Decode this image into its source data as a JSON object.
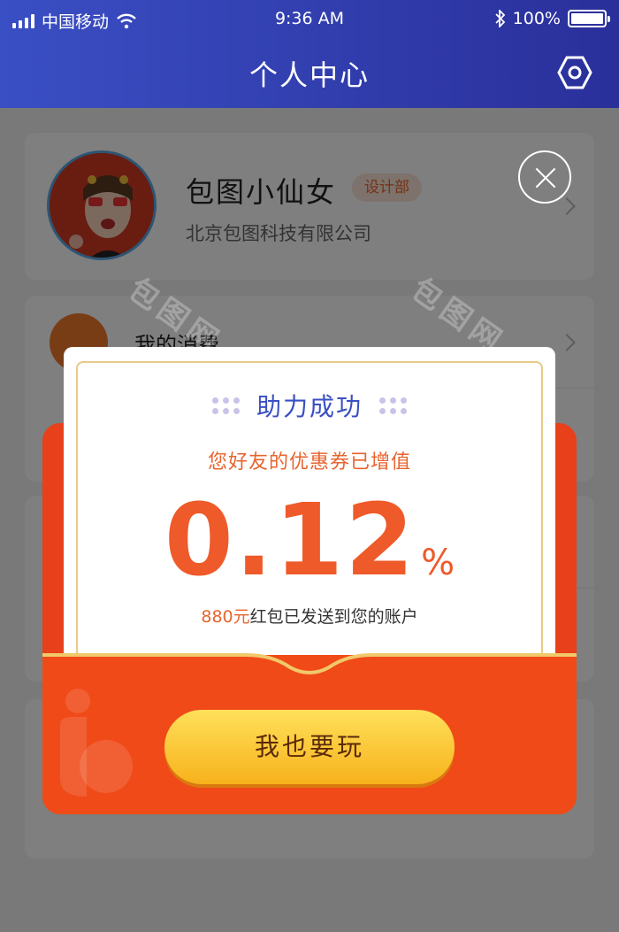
{
  "status_bar": {
    "carrier": "中国移动",
    "time": "9:36 AM",
    "battery": "100%"
  },
  "nav": {
    "title": "个人中心",
    "settings_icon": "gear-hex-icon"
  },
  "profile": {
    "name": "包图小仙女",
    "department": "设计部",
    "company": "北京包图科技有限公司"
  },
  "menu": {
    "item1_label": "我的消费"
  },
  "watermark": "包图网",
  "popup": {
    "headline": "助力成功",
    "subline": "您好友的优惠券已增值",
    "value": "0.12",
    "unit": "%",
    "note_amount": "880元",
    "note_text": "红包已发送到您的账户",
    "cta_label": "我也要玩"
  },
  "colors": {
    "header_start": "#3a4fc4",
    "header_end": "#2a2f9a",
    "envelope_red": "#e8401a",
    "accent_orange": "#ef5a2a",
    "cta_yellow": "#f7b21c"
  }
}
